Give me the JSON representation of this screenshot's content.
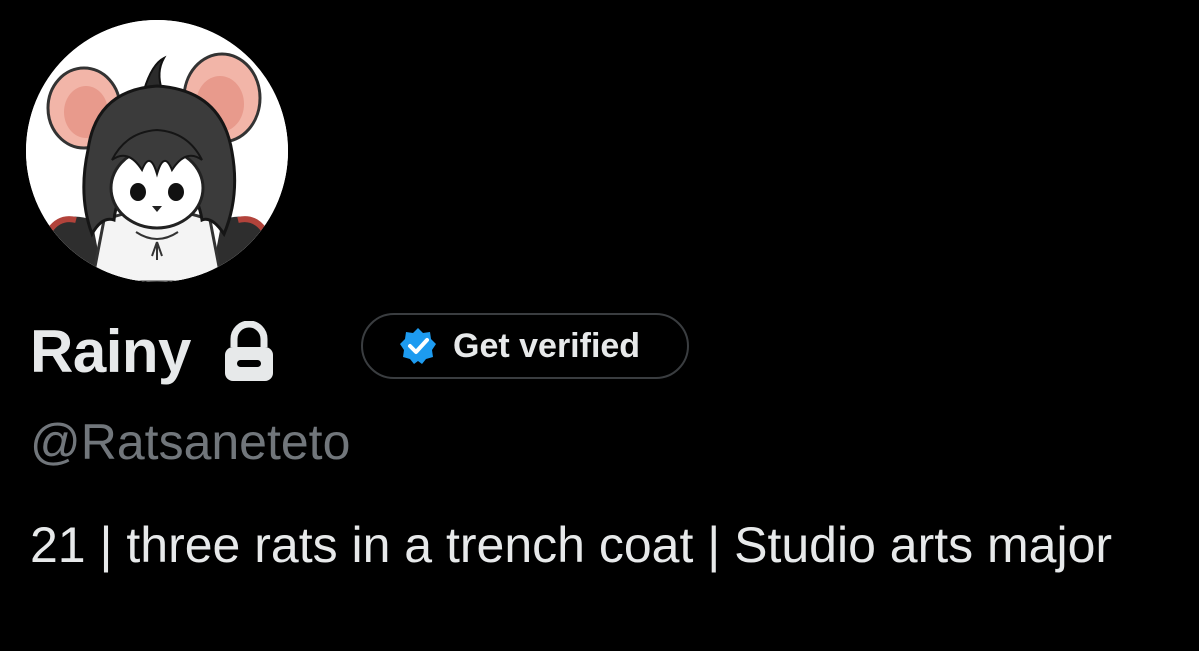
{
  "profile": {
    "display_name": "Rainy",
    "handle": "@Ratsaneteto",
    "bio": "21 | three rats in a trench coat | Studio arts major",
    "avatar_icon": "rat-character-avatar",
    "protected_icon": "lock-icon"
  },
  "verify": {
    "label": "Get verified",
    "icon": "verified-badge-icon",
    "badge_color": "#1d9bf0"
  },
  "colors": {
    "background": "#000000",
    "primary_text": "#e7e9ea",
    "secondary_text": "#71767b",
    "button_border": "#3a3d40"
  }
}
